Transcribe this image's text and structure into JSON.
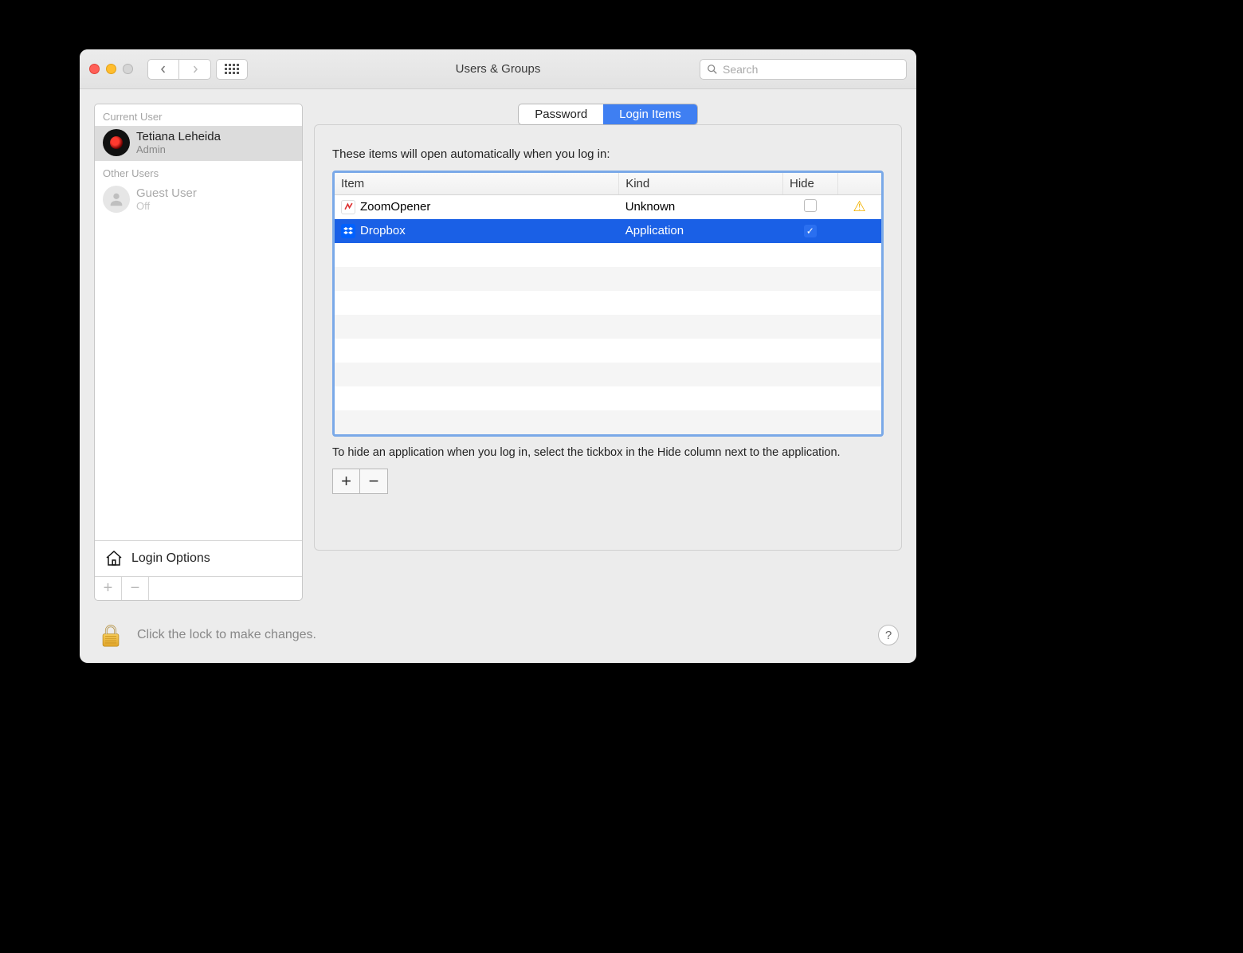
{
  "window": {
    "title": "Users & Groups",
    "search_placeholder": "Search"
  },
  "sidebar": {
    "current_user_label": "Current User",
    "other_users_label": "Other Users",
    "current_user": {
      "name": "Tetiana Leheida",
      "role": "Admin"
    },
    "other_users": [
      {
        "name": "Guest User",
        "status": "Off"
      }
    ],
    "login_options_label": "Login Options"
  },
  "tabs": {
    "password": "Password",
    "login_items": "Login Items",
    "active": "login_items"
  },
  "login_items_panel": {
    "heading": "These items will open automatically when you log in:",
    "columns": {
      "item": "Item",
      "kind": "Kind",
      "hide": "Hide"
    },
    "rows": [
      {
        "name": "ZoomOpener",
        "kind": "Unknown",
        "hide": false,
        "warning": true,
        "icon": "zoom",
        "selected": false
      },
      {
        "name": "Dropbox",
        "kind": "Application",
        "hide": true,
        "warning": false,
        "icon": "dropbox",
        "selected": true
      }
    ],
    "hint": "To hide an application when you log in, select the tickbox in the Hide column next to the application."
  },
  "footer": {
    "lock_text": "Click the lock to make changes."
  }
}
